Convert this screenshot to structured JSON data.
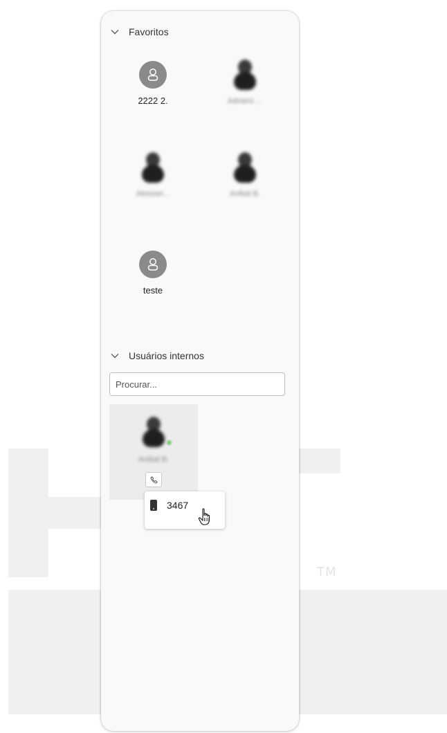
{
  "favorites": {
    "title": "Favoritos",
    "contacts": [
      {
        "name": "2222 2.",
        "avatar": "default-user-icon"
      },
      {
        "name": "Adriano ...",
        "avatar": "photo-blurred"
      },
      {
        "name": "Alessan...",
        "avatar": "photo-blurred"
      },
      {
        "name": "Anibal B.",
        "avatar": "photo-blurred"
      },
      {
        "name": "teste",
        "avatar": "default-user-icon"
      }
    ]
  },
  "internal_users": {
    "title": "Usuários internos",
    "search_placeholder": "Procurar...",
    "users": [
      {
        "name": "Anibal B.",
        "status_color": "#7fc97f",
        "extension": "3467"
      }
    ]
  },
  "watermark": {
    "tm": "TM"
  },
  "colors": {
    "panel_bg": "#f9f9f9",
    "avatar_default": "#8a8a8a",
    "card_bg": "#ececec",
    "status_online": "#7fc97f"
  }
}
